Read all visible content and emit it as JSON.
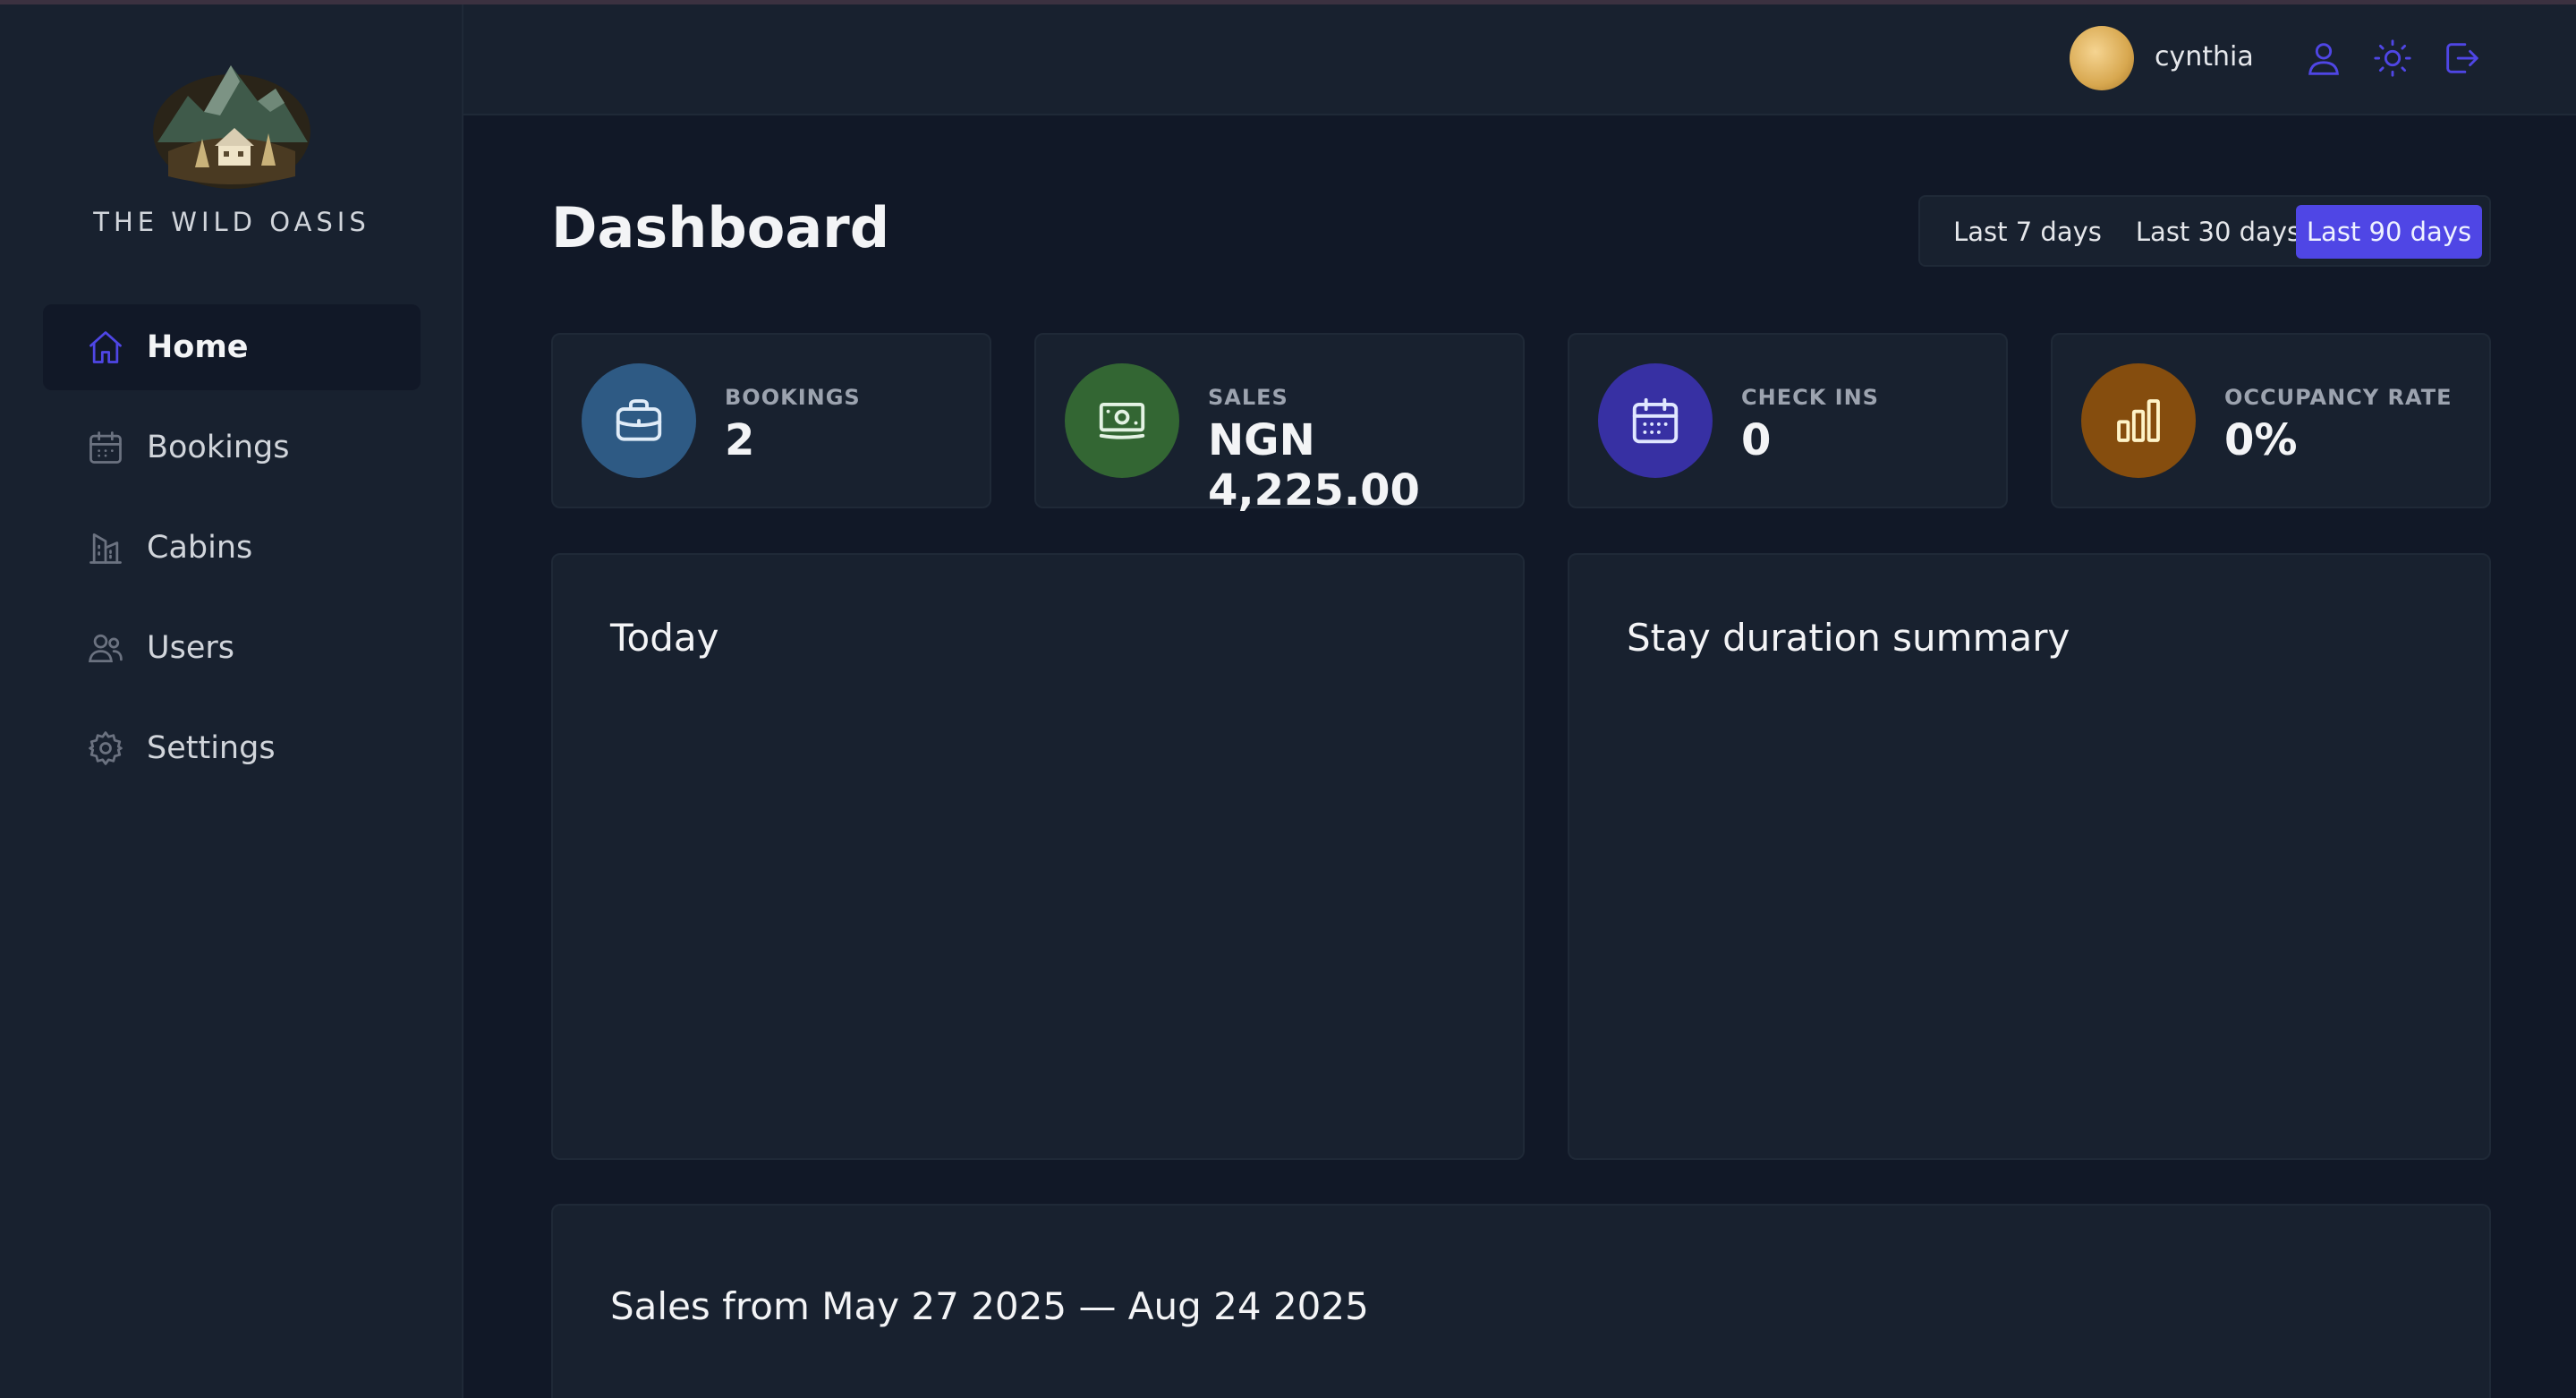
{
  "app": {
    "brand": "THE WILD OASIS"
  },
  "sidebar": {
    "items": [
      {
        "label": "Home",
        "icon": "home-icon",
        "active": true
      },
      {
        "label": "Bookings",
        "icon": "calendar-icon",
        "active": false
      },
      {
        "label": "Cabins",
        "icon": "building-icon",
        "active": false
      },
      {
        "label": "Users",
        "icon": "users-icon",
        "active": false
      },
      {
        "label": "Settings",
        "icon": "gear-icon",
        "active": false
      }
    ]
  },
  "header": {
    "username": "cynthia",
    "icons": [
      "user-icon",
      "sun-icon",
      "logout-icon"
    ]
  },
  "main": {
    "title": "Dashboard",
    "filters": [
      {
        "label": "Last 7 days",
        "active": false
      },
      {
        "label": "Last 30 days",
        "active": false
      },
      {
        "label": "Last 90 days",
        "active": true
      }
    ],
    "stats": [
      {
        "label": "BOOKINGS",
        "value": "2",
        "icon": "briefcase-icon",
        "color": "#2e5a84"
      },
      {
        "label": "SALES",
        "value": "NGN 4,225.00",
        "icon": "banknotes-icon",
        "color": "#336633"
      },
      {
        "label": "CHECK INS",
        "value": "0",
        "icon": "calendar-days-icon",
        "color": "#3730a3"
      },
      {
        "label": "OCCUPANCY RATE",
        "value": "0%",
        "icon": "chart-bar-icon",
        "color": "#854d0e"
      }
    ],
    "today_title": "Today",
    "duration_title": "Stay duration summary",
    "sales_title": "Sales from May 27 2025 — Aug 24 2025"
  },
  "colors": {
    "accent": "#4f46e5",
    "background": "#111827",
    "surface": "#18212f",
    "border": "#1f2937"
  }
}
